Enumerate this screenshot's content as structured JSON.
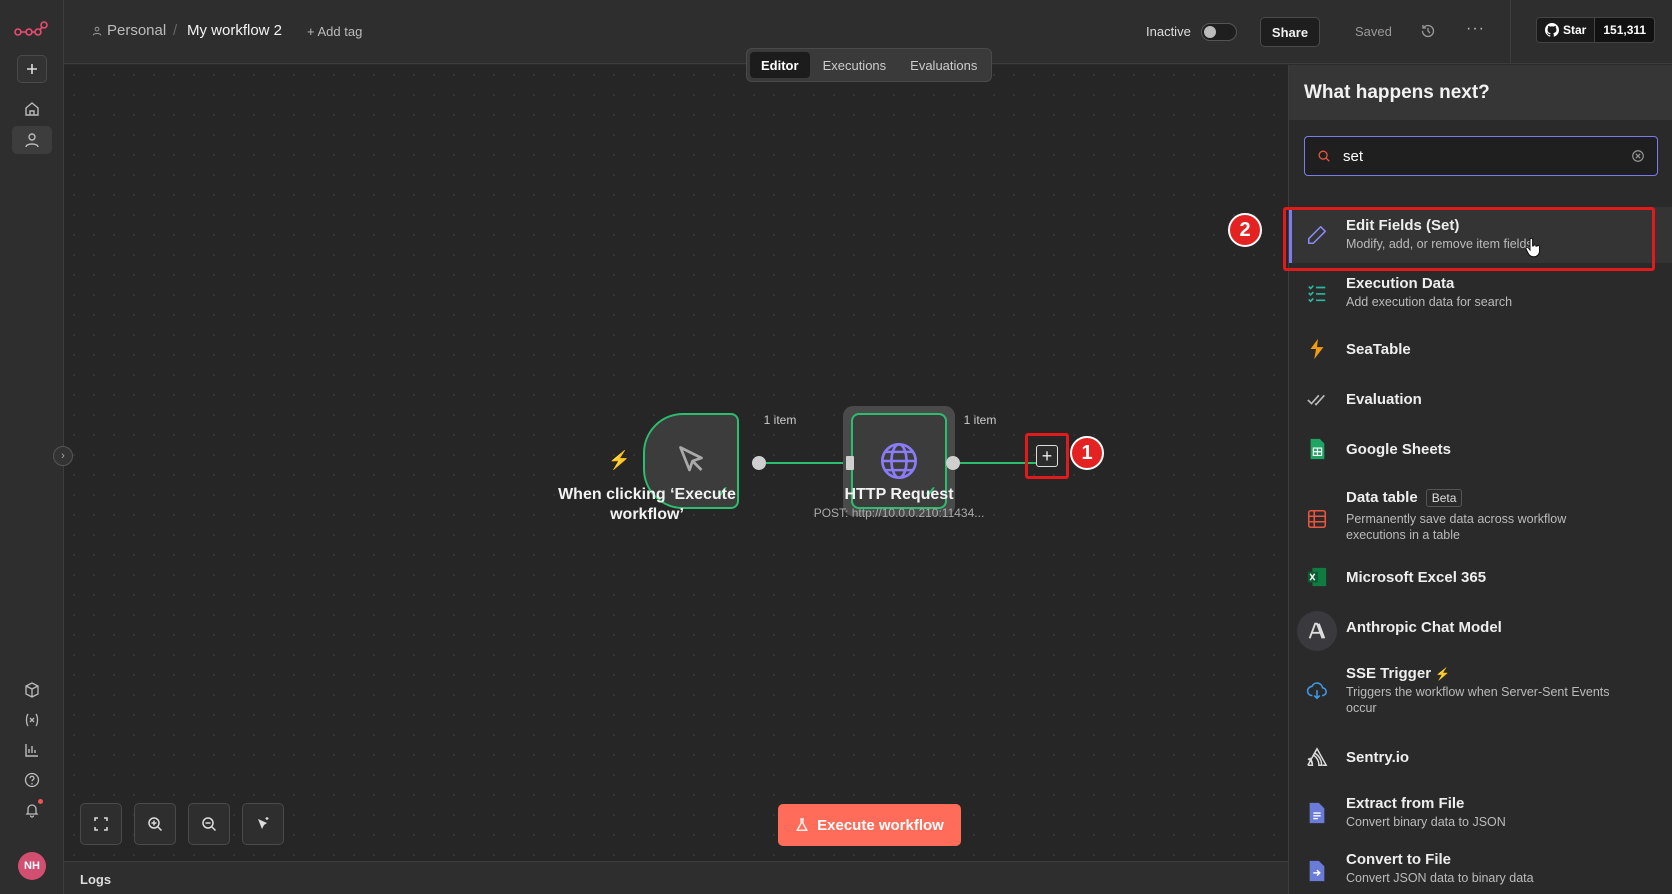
{
  "header": {
    "project": "Personal",
    "separator": "/",
    "workflow_title": "My workflow 2",
    "add_tag": "+ Add tag",
    "status_label": "Inactive",
    "share_label": "Share",
    "saved_label": "Saved",
    "more_label": "···",
    "github_star": "Star",
    "github_count": "151,311"
  },
  "sidebar": {
    "avatar_initials": "NH"
  },
  "tabs": [
    "Editor",
    "Executions",
    "Evaluations"
  ],
  "canvas": {
    "trigger_node": {
      "label": "When clicking ‘Execute workflow’"
    },
    "http_node": {
      "label": "HTTP Request",
      "subtitle": "POST: http://10.0.0.210:11434..."
    },
    "connection_1_label": "1 item",
    "connection_2_label": "1 item",
    "annotation_1": "1",
    "annotation_2": "2",
    "execute_label": "Execute workflow",
    "logs_label": "Logs"
  },
  "panel": {
    "title": "What happens next?",
    "search_value": "set",
    "items": [
      {
        "title": "Edit Fields (Set)",
        "desc": "Modify, add, or remove item fields",
        "icon": "pencil-icon"
      },
      {
        "title": "Execution Data",
        "desc": "Add execution data for search",
        "icon": "checklist-icon"
      },
      {
        "title": "SeaTable",
        "desc": "",
        "icon": "seatable-icon"
      },
      {
        "title": "Evaluation",
        "desc": "",
        "icon": "double-check-icon"
      },
      {
        "title": "Google Sheets",
        "desc": "",
        "icon": "google-sheets-icon"
      },
      {
        "title": "Data table",
        "badge": "Beta",
        "desc": "Permanently save data across workflow executions in a table",
        "icon": "table-icon"
      },
      {
        "title": "Microsoft Excel 365",
        "desc": "",
        "icon": "excel-icon"
      },
      {
        "title": "Anthropic Chat Model",
        "desc": "",
        "icon": "anthropic-icon"
      },
      {
        "title": "SSE Trigger",
        "desc": "Triggers the workflow when Server-Sent Events occur",
        "icon": "cloud-download-icon"
      },
      {
        "title": "Sentry.io",
        "desc": "",
        "icon": "sentry-icon"
      },
      {
        "title": "Extract from File",
        "desc": "Convert binary data to JSON",
        "icon": "file-extract-icon"
      },
      {
        "title": "Convert to File",
        "desc": "Convert JSON data to binary data",
        "icon": "file-convert-icon"
      }
    ]
  },
  "colors": {
    "accent": "#ff6d5a",
    "success": "#2dbd6e",
    "highlight": "#e01b1b",
    "focus": "#7c7cf0"
  }
}
